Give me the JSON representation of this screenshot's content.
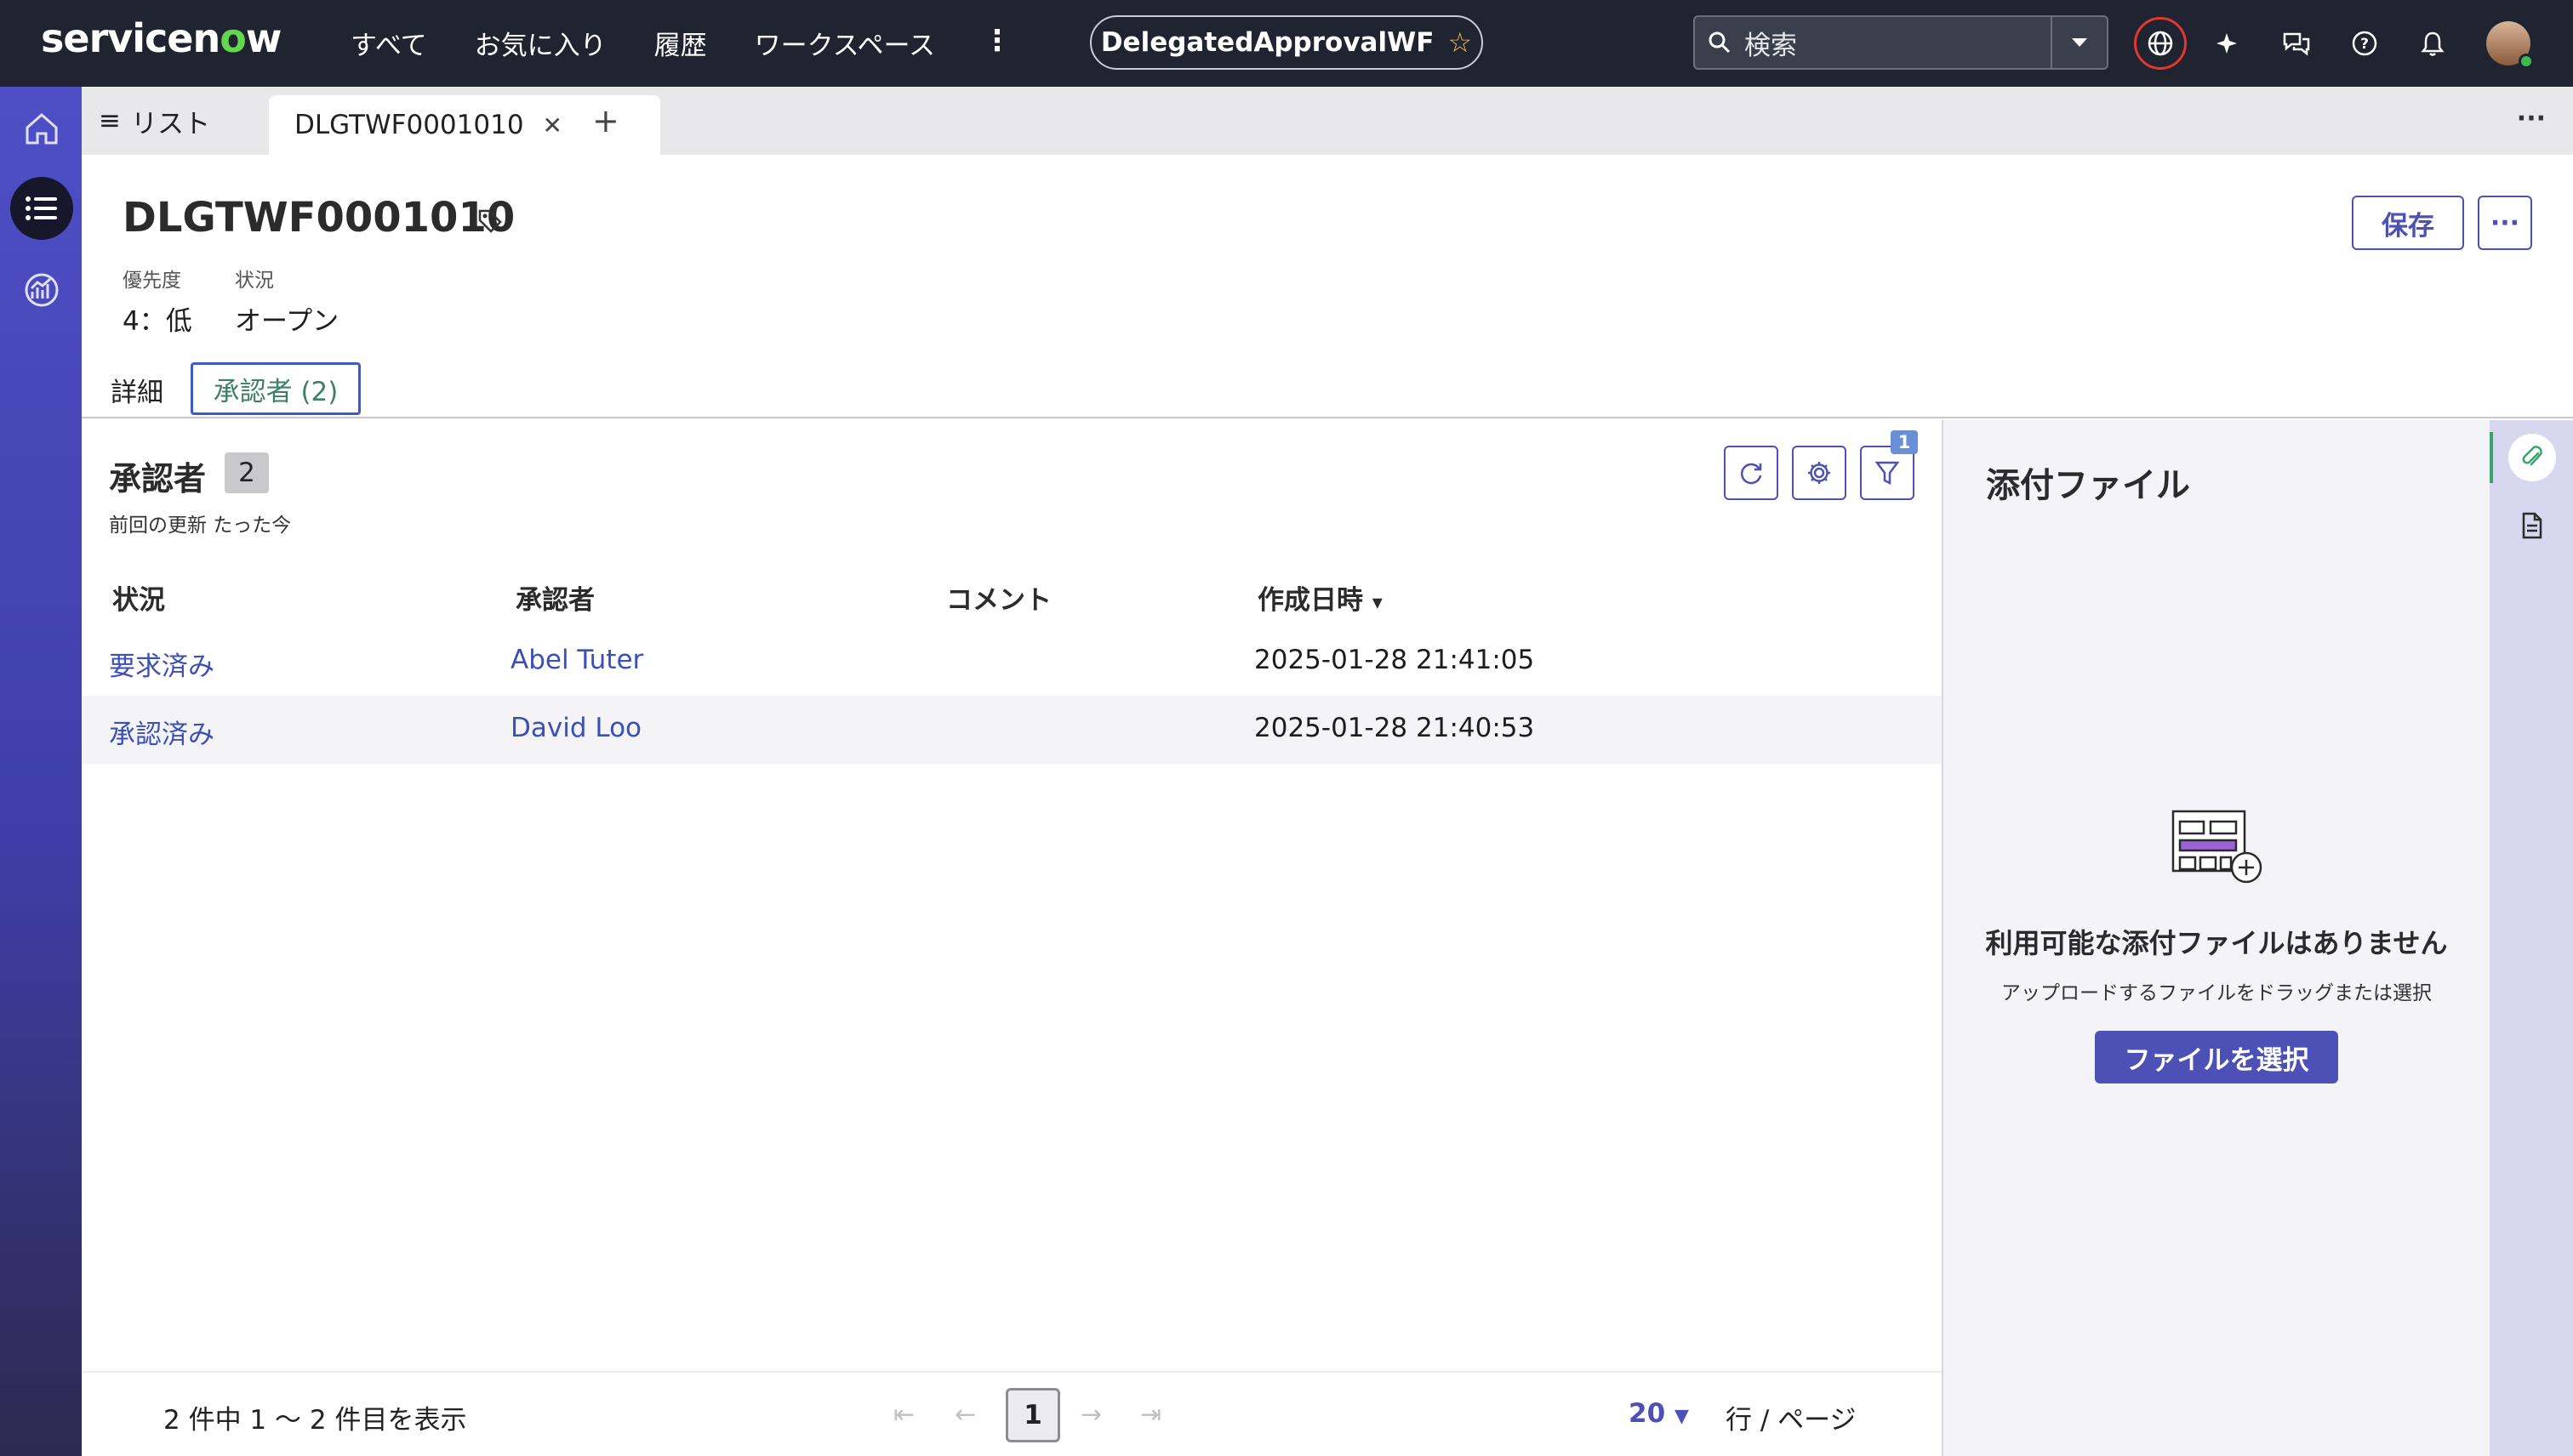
{
  "header": {
    "logo": {
      "prefix": "servicen",
      "o": "o",
      "suffix": "w"
    },
    "nav": [
      "すべて",
      "お気に入り",
      "履歴",
      "ワークスペース"
    ],
    "context_pill": "DelegatedApprovalWF",
    "search_placeholder": "検索"
  },
  "tabs": {
    "list_label": "リスト",
    "active_tab": "DLGTWF0001010"
  },
  "record": {
    "number": "DLGTWF0001010",
    "save_label": "保存",
    "more_label": "···",
    "priority_label": "優先度",
    "priority_value": "4：低",
    "state_label": "状況",
    "state_value": "オープン",
    "tab_detail": "詳細",
    "tab_approvers": "承認者 (2)"
  },
  "approvers": {
    "title": "承認者",
    "count": "2",
    "last_updated": "前回の更新 たった今",
    "filter_badge": "1",
    "columns": [
      "状況",
      "承認者",
      "コメント",
      "作成日時"
    ],
    "sort_indicator": "▾",
    "rows": [
      {
        "state": "要求済み",
        "approver": "Abel Tuter",
        "comment": "",
        "created": "2025-01-28 21:41:05"
      },
      {
        "state": "承認済み",
        "approver": "David Loo",
        "comment": "",
        "created": "2025-01-28 21:40:53"
      }
    ]
  },
  "pager": {
    "info": "2 件中 1 〜 2 件目を表示",
    "page": "1",
    "rows_per_page": "20",
    "rows_label": "行 / ページ"
  },
  "attachments": {
    "title": "添付ファイル",
    "empty_title": "利用可能な添付ファイルはありません",
    "hint": "アップロードするファイルをドラッグまたは選択",
    "select_button": "ファイルを選択"
  },
  "colors": {
    "header_bg": "#1f2430",
    "accent": "#4d50b5",
    "link": "#3b4fb8",
    "logo_o": "#62d84e"
  }
}
